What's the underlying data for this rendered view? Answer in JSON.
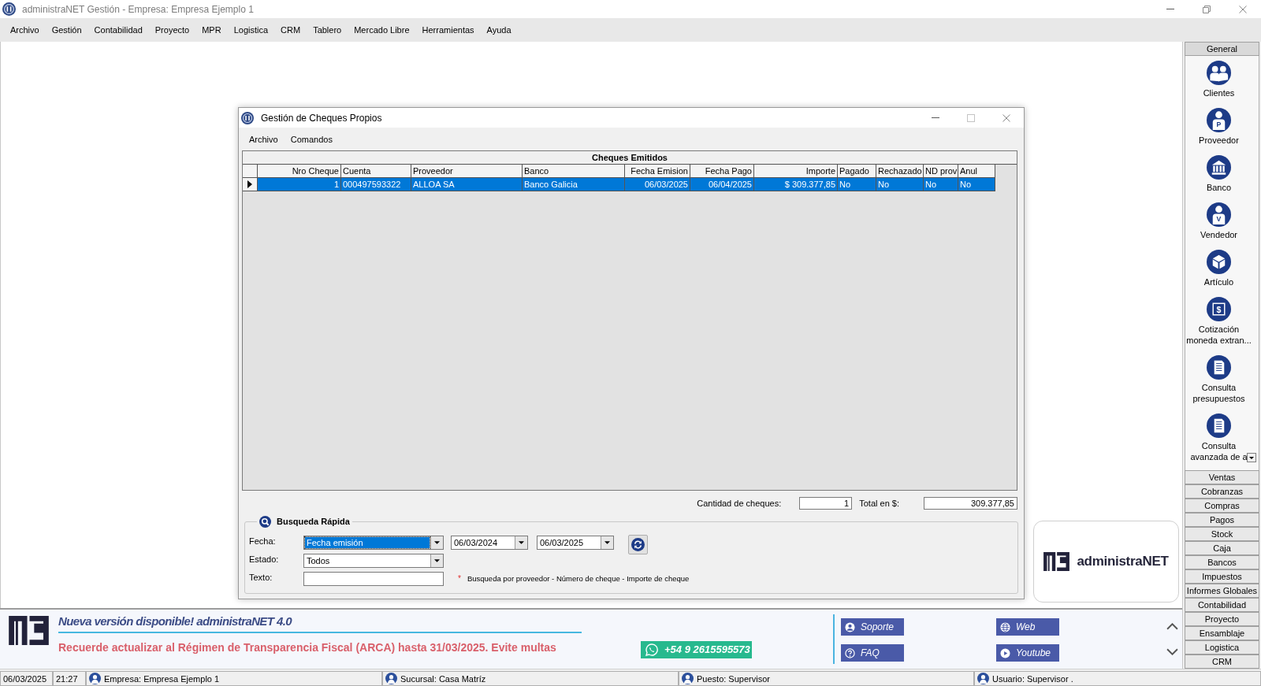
{
  "window": {
    "title": "administraNET Gestión - Empresa: Empresa Ejemplo 1"
  },
  "menu_bar": [
    "Archivo",
    "Gestión",
    "Contabilidad",
    "Proyecto",
    "MPR",
    "Logistica",
    "CRM",
    "Tablero",
    "Mercado Libre",
    "Herramientas",
    "Ayuda"
  ],
  "dialog": {
    "title": "Gestión de Cheques Propios",
    "menu": [
      "Archivo",
      "Comandos"
    ],
    "table": {
      "title": "Cheques Emitidos",
      "columns": [
        {
          "label": "Nro Cheque",
          "kind": "number"
        },
        {
          "label": "Cuenta",
          "kind": "text"
        },
        {
          "label": "Proveedor",
          "kind": "text"
        },
        {
          "label": "Banco",
          "kind": "text"
        },
        {
          "label": "Fecha Emision",
          "kind": "number"
        },
        {
          "label": "Fecha Pago",
          "kind": "number"
        },
        {
          "label": "Importe",
          "kind": "number"
        },
        {
          "label": "Pagado",
          "kind": "text"
        },
        {
          "label": "Rechazado",
          "kind": "text"
        },
        {
          "label": "ND prov",
          "kind": "text"
        },
        {
          "label": "Anul",
          "kind": "text"
        }
      ],
      "rows": [
        {
          "selected": true,
          "cells": [
            "1",
            "000497593322",
            "ALLOA SA",
            "Banco Galicia",
            "06/03/2025",
            "06/04/2025",
            "$ 309.377,85",
            "No",
            "No",
            "No",
            "No"
          ]
        }
      ]
    },
    "summary": {
      "count_label": "Cantidad de cheques:",
      "count": "1",
      "total_label": "Total en $:",
      "total": "309.377,85"
    },
    "quick_search": {
      "title": "Busqueda Rápida",
      "date_label": "Fecha:",
      "date_field": {
        "value": "Fecha emisión",
        "focused": true
      },
      "date_from": "06/03/2024",
      "date_to": "06/03/2025",
      "status_label": "Estado:",
      "status_field": {
        "value": "Todos",
        "focused": false
      },
      "text_label": "Texto:",
      "hint_mark": "*",
      "hint": "Busqueda por proveedor - Número de cheque - Importe de cheque"
    }
  },
  "logo_card": {
    "name": "administraNET"
  },
  "sidebar": {
    "sections": [
      {
        "label": "General",
        "expanded": true,
        "items": [
          {
            "label": "Clientes",
            "kind": "people"
          },
          {
            "label": "Proveedor",
            "kind": "person",
            "badge": "P"
          },
          {
            "label": "Banco",
            "kind": "bank"
          },
          {
            "label": "Vendedor",
            "kind": "person",
            "badge": "V"
          },
          {
            "label": "Artículo",
            "kind": "cube"
          },
          {
            "label": "Cotización moneda extran...",
            "kind": "money",
            "badge": "$"
          },
          {
            "label": "Consulta presupuestos",
            "kind": "document"
          },
          {
            "label": "Consulta avanzada de a",
            "kind": "document"
          }
        ]
      },
      {
        "label": "Ventas",
        "expanded": false
      },
      {
        "label": "Cobranzas",
        "expanded": false
      },
      {
        "label": "Compras",
        "expanded": false
      },
      {
        "label": "Pagos",
        "expanded": false
      },
      {
        "label": "Stock",
        "expanded": false
      },
      {
        "label": "Caja",
        "expanded": false
      },
      {
        "label": "Bancos",
        "expanded": false
      },
      {
        "label": "Impuestos",
        "expanded": false
      },
      {
        "label": "Informes Globales",
        "expanded": false
      },
      {
        "label": "Contabilidad",
        "expanded": false
      },
      {
        "label": "Proyecto",
        "expanded": false
      },
      {
        "label": "Ensamblaje",
        "expanded": false
      },
      {
        "label": "Logistica",
        "expanded": false
      },
      {
        "label": "CRM",
        "expanded": false
      }
    ]
  },
  "banner": {
    "headline": "Nueva versión disponible! administraNET 4.0",
    "notice": "Recuerde actualizar al Régimen de Transparencia Fiscal (ARCA) hasta 31/03/2025. Evite multas",
    "phone": "+54 9 2615595573",
    "links": [
      {
        "label": "Soporte",
        "kind": "support"
      },
      {
        "label": "Web",
        "kind": "web"
      },
      {
        "label": "FAQ",
        "kind": "faq"
      },
      {
        "label": "Youtube",
        "kind": "video"
      }
    ]
  },
  "status_bar": [
    {
      "text": "06/03/2025",
      "kind": "text"
    },
    {
      "text": "21:27",
      "kind": "text"
    },
    {
      "text": "Empresa: Empresa Ejemplo 1",
      "kind": "person"
    },
    {
      "text": "Sucursal: Casa Matríz",
      "kind": "person"
    },
    {
      "text": "Puesto: Supervisor",
      "kind": "person"
    },
    {
      "text": "Usuario: Supervisor .",
      "kind": "person"
    }
  ]
}
